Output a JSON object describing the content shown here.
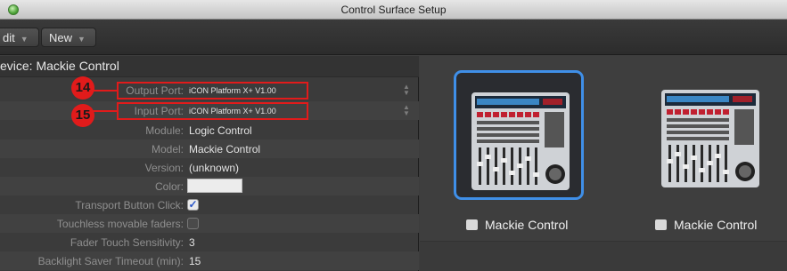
{
  "window": {
    "title": "Control Surface Setup"
  },
  "toolbar": {
    "edit_label": "dit",
    "new_label": "New",
    "chevron": "▼"
  },
  "device": {
    "header": "evice: Mackie Control"
  },
  "settings": {
    "output_port": {
      "label": "Output Port:",
      "value": "iCON Platform X+ V1.00"
    },
    "input_port": {
      "label": "Input Port:",
      "value": "iCON Platform X+ V1.00"
    },
    "module": {
      "label": "Module:",
      "value": "Logic Control"
    },
    "model": {
      "label": "Model:",
      "value": "Mackie Control"
    },
    "version": {
      "label": "Version:",
      "value": "(unknown)"
    },
    "color": {
      "label": "Color:",
      "value": "#ececec"
    },
    "transport_click": {
      "label": "Transport Button Click:",
      "checked": true,
      "mark": "✓"
    },
    "touchless_faders": {
      "label": "Touchless movable faders:",
      "checked": false
    },
    "fader_touch": {
      "label": "Fader Touch Sensitivity:",
      "value": "3"
    },
    "backlight": {
      "label": "Backlight Saver Timeout (min):",
      "value": "15"
    }
  },
  "annotations": [
    {
      "number": "14",
      "target": "output-port"
    },
    {
      "number": "15",
      "target": "input-port"
    }
  ],
  "devices": [
    {
      "name": "Mackie Control",
      "selected": true
    },
    {
      "name": "Mackie Control",
      "selected": false
    }
  ],
  "colors": {
    "highlight": "#e11b1b",
    "selection": "#3f8fe8",
    "checkmark": "#2a56c8"
  },
  "icons": {
    "stepper": "up-down-stepper-icon",
    "window_button": "green-window-button-icon"
  }
}
